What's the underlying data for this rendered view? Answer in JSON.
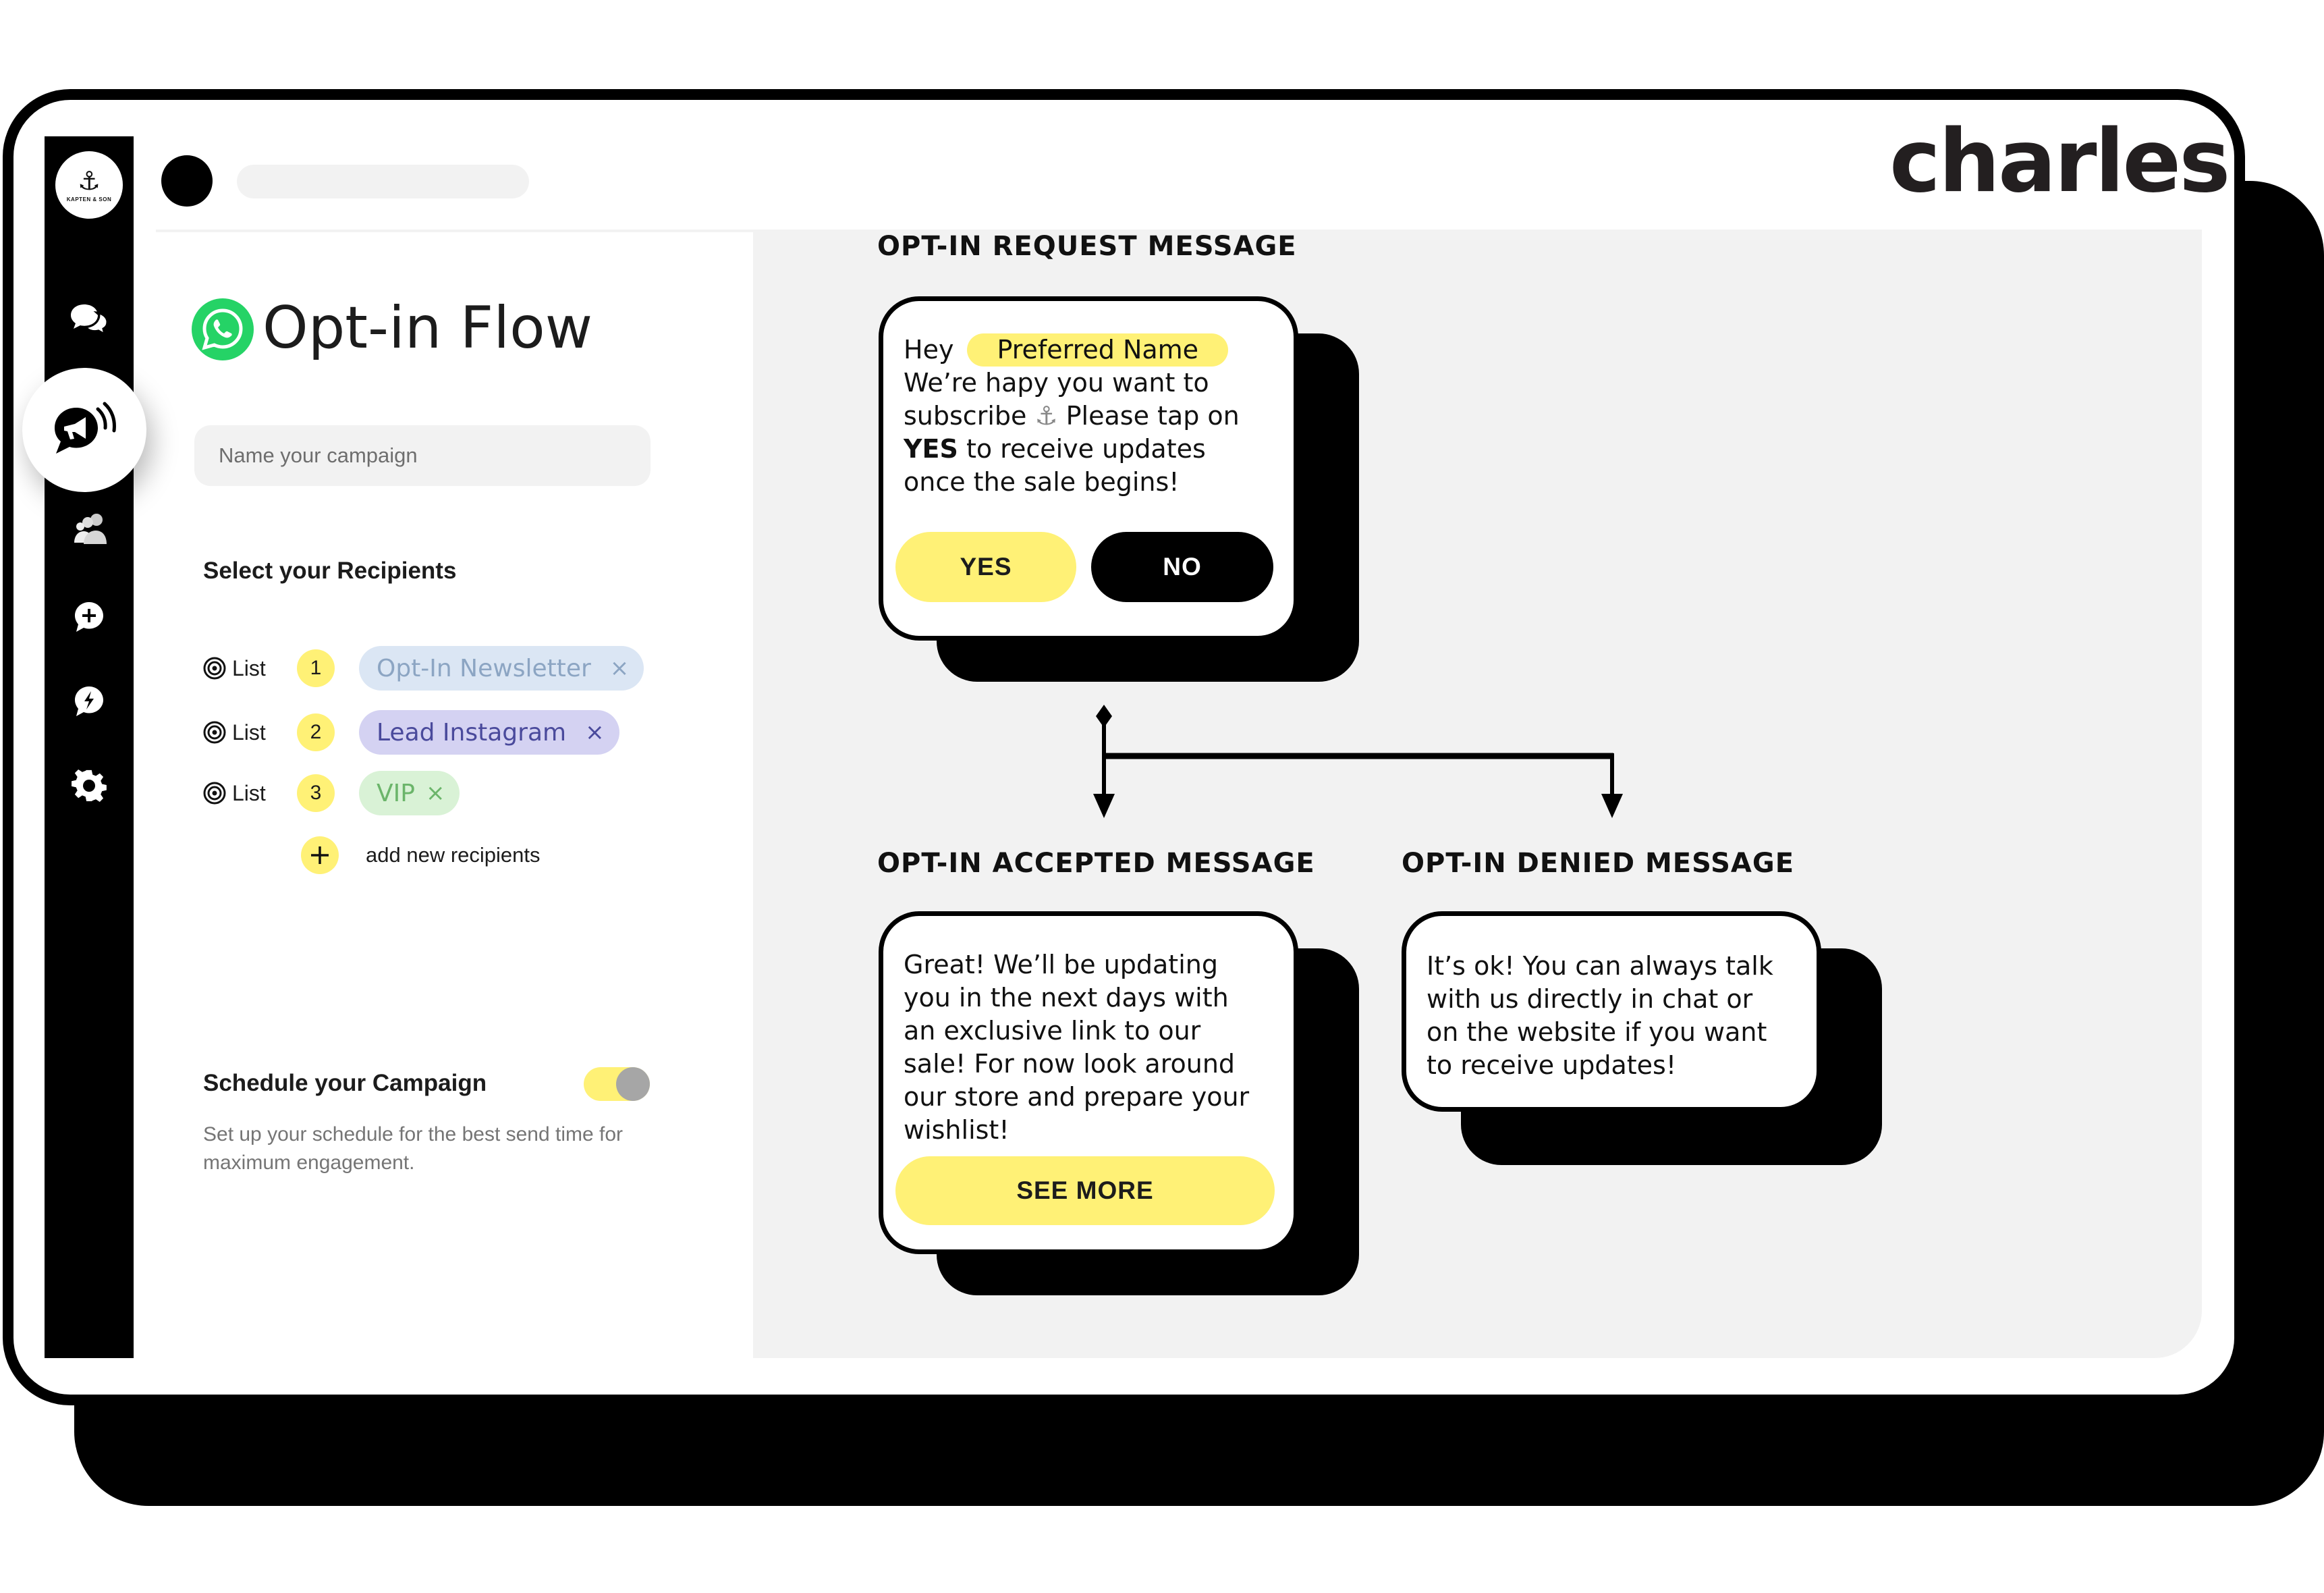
{
  "brand": {
    "logo_icon": "anchor-icon",
    "logo_glyph": "⚓",
    "name": "KAPTEN & SON"
  },
  "sidebar": {
    "items": [
      {
        "name": "conversations",
        "icon": "chat-bubbles-icon",
        "active": false
      },
      {
        "name": "campaigns",
        "icon": "megaphone-icon",
        "active": true
      },
      {
        "name": "audiences",
        "icon": "people-icon",
        "active": false
      },
      {
        "name": "new-message",
        "icon": "chat-plus-icon",
        "active": false
      },
      {
        "name": "automations",
        "icon": "chat-lightning-icon",
        "active": false
      },
      {
        "name": "settings",
        "icon": "gear-icon",
        "active": false
      }
    ]
  },
  "header": {
    "logo_text": "charles"
  },
  "page": {
    "title": "Opt-in Flow",
    "title_icon": "whatsapp-icon",
    "campaign_name": {
      "value": "",
      "placeholder": "Name your campaign"
    }
  },
  "recipients": {
    "title": "Select your Recipients",
    "lists": [
      {
        "label": "List",
        "number": "1",
        "chip": "Opt-In Newsletter",
        "remove": "×",
        "color": "#dbe6f4",
        "text_color": "#8ca5c3"
      },
      {
        "label": "List",
        "number": "2",
        "chip": "Lead Instagram",
        "remove": "×",
        "color": "#d4d2f2",
        "text_color": "#4a4a9c"
      },
      {
        "label": "List",
        "number": "3",
        "chip": "VIP",
        "remove": "×",
        "color": "#d9f2d6",
        "text_color": "#6bb56a"
      }
    ],
    "add_label": "add new recipients",
    "add_glyph": "+"
  },
  "schedule": {
    "title": "Schedule your Campaign",
    "description": "Set up your schedule for the best send time for maximum engagement.",
    "enabled": true
  },
  "flow": {
    "request": {
      "label": "OPT-IN REQUEST MESSAGE",
      "greeting": "Hey",
      "variable": "Preferred Name",
      "line1": "We’re hapy you want to",
      "line2a": "subscribe",
      "emoji": "⚓",
      "line2b": "Please tap on",
      "bold": "YES",
      "line3": "to receive updates",
      "line4": "once the sale begins!",
      "yes_label": "YES",
      "no_label": "NO"
    },
    "accepted": {
      "label": "OPT-IN ACCEPTED MESSAGE",
      "lines": [
        "Great! We’ll be updating",
        "you in the next days with",
        "an exclusive link to our",
        "sale! For now look around",
        "our store and prepare your",
        "wishlist!"
      ],
      "button_label": "SEE MORE"
    },
    "denied": {
      "label": "OPT-IN DENIED MESSAGE",
      "lines": [
        "It’s ok! You can always talk",
        "with us directly in chat or",
        "on the website if you want",
        "to receive updates!"
      ]
    }
  },
  "colors": {
    "accent_yellow": "#fff176",
    "panel_grey": "#f2f2f2",
    "whatsapp_green": "#25d366",
    "black": "#000000"
  }
}
